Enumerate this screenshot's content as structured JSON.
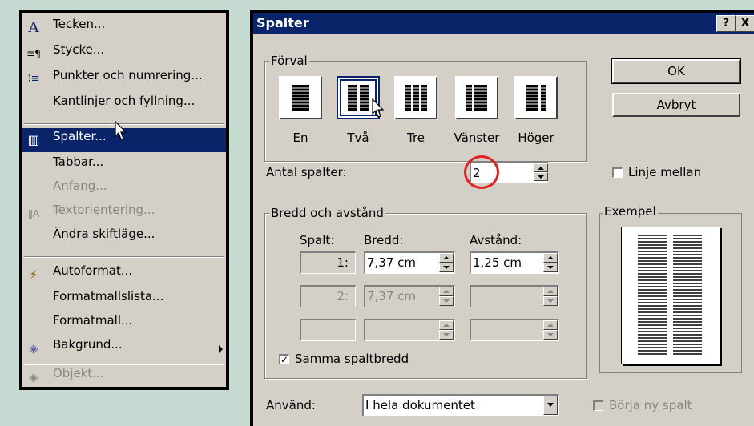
{
  "menu": {
    "items": [
      {
        "icon": "A",
        "label": "Tecken...",
        "state": "normal"
      },
      {
        "icon": "≡¶",
        "label": "Stycke...",
        "state": "normal"
      },
      {
        "icon": "⁝≡",
        "label": "Punkter och numrering...",
        "state": "normal"
      },
      {
        "icon": "",
        "label": "Kantlinjer och fyllning...",
        "state": "normal"
      },
      {
        "icon": "▥",
        "label": "Spalter...",
        "state": "selected"
      },
      {
        "icon": "",
        "label": "Tabbar...",
        "state": "normal"
      },
      {
        "icon": "",
        "label": "Anfang...",
        "state": "disabled"
      },
      {
        "icon": "ǁA",
        "label": "Textorientering...",
        "state": "disabled"
      },
      {
        "icon": "",
        "label": "Ändra skiftläge...",
        "state": "normal"
      },
      {
        "icon": "⚡",
        "label": "Autoformat...",
        "state": "normal"
      },
      {
        "icon": "",
        "label": "Formatmallslista...",
        "state": "normal"
      },
      {
        "icon": "",
        "label": "Formatmall...",
        "state": "normal"
      },
      {
        "icon": "◈",
        "label": "Bakgrund...",
        "state": "normal"
      },
      {
        "icon": "◈",
        "label": "Objekt...",
        "state": "disabled"
      }
    ]
  },
  "dialog": {
    "title": "Spalter",
    "help_btn": "?",
    "close_btn": "X",
    "ok": "OK",
    "cancel": "Avbryt",
    "preset_group": "Förval",
    "presets": [
      {
        "label": "En",
        "columns": 1
      },
      {
        "label": "Två",
        "columns": 2
      },
      {
        "label": "Tre",
        "columns": 3
      },
      {
        "label": "Vänster",
        "columns": "left"
      },
      {
        "label": "Höger",
        "columns": "right"
      }
    ],
    "selected_preset": "Två",
    "num_columns_label": "Antal spalter:",
    "num_columns_value": "2",
    "line_between_label": "Linje mellan",
    "line_between_checked": false,
    "width_group": "Bredd och avstånd",
    "col_header": "Spalt:",
    "width_header": "Bredd:",
    "spacing_header": "Avstånd:",
    "rows": [
      {
        "col": "1:",
        "width": "7,37 cm",
        "spacing": "1,25 cm",
        "enabled": true
      },
      {
        "col": "2:",
        "width": "7,37 cm",
        "spacing": "",
        "enabled": false
      },
      {
        "col": "",
        "width": "",
        "spacing": "",
        "enabled": false
      }
    ],
    "equal_width_label": "Samma spaltbredd",
    "equal_width_checked": true,
    "apply_label": "Använd:",
    "apply_value": "I hela dokumentet",
    "new_column_label": "Börja ny spalt",
    "new_column_checked": false,
    "example_group": "Exempel"
  },
  "colors": {
    "highlight": "#0a246a",
    "face": "#d4d0c8",
    "annotation": "#e02020",
    "background": "#c6dcd2"
  }
}
